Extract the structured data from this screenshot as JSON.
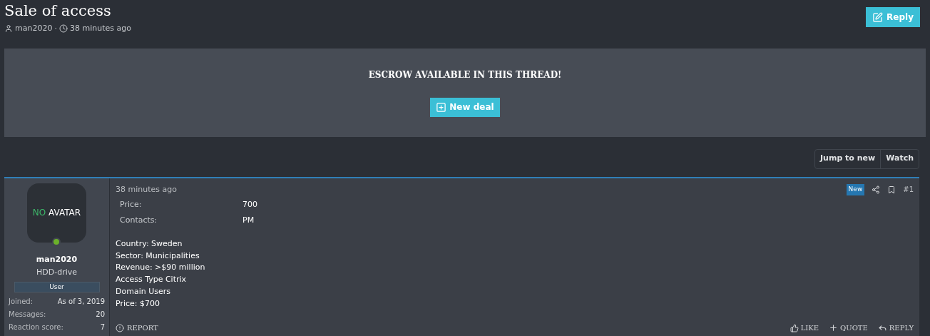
{
  "thread": {
    "title": "Sale of access",
    "author": "man2020",
    "separator": "·",
    "time": "38 minutes ago"
  },
  "reply_button": "Reply",
  "escrow": {
    "text": "ESCROW AVAILABLE IN THIS THREAD!",
    "button": "New deal"
  },
  "thread_buttons": [
    "Jump to new",
    "Watch"
  ],
  "post": {
    "user": {
      "avatar_first": "NO",
      "avatar_second": "AVATAR",
      "online": true,
      "name": "man2020",
      "title": "HDD-drive",
      "role": "User",
      "stats": [
        {
          "label": "Joined:",
          "value": "As of 3, 2019"
        },
        {
          "label": "Messages:",
          "value": "20"
        },
        {
          "label": "Reaction score:",
          "value": "7"
        }
      ]
    },
    "time": "38 minutes ago",
    "badge": "New",
    "number": "#1",
    "fields": [
      {
        "label": "Price:",
        "value": "700"
      },
      {
        "label": "Contacts:",
        "value": "PM"
      }
    ],
    "lines": [
      "Country: Sweden",
      "Sector: Municipalities",
      "Revenue: >$90 million",
      "Access Type Citrix",
      "Domain Users",
      "Price: $700"
    ],
    "report": "REPORT",
    "actions": [
      {
        "kind": "like",
        "label": "LIKE"
      },
      {
        "kind": "quote",
        "label": "QUOTE"
      },
      {
        "kind": "reply",
        "label": "REPLY"
      }
    ]
  }
}
